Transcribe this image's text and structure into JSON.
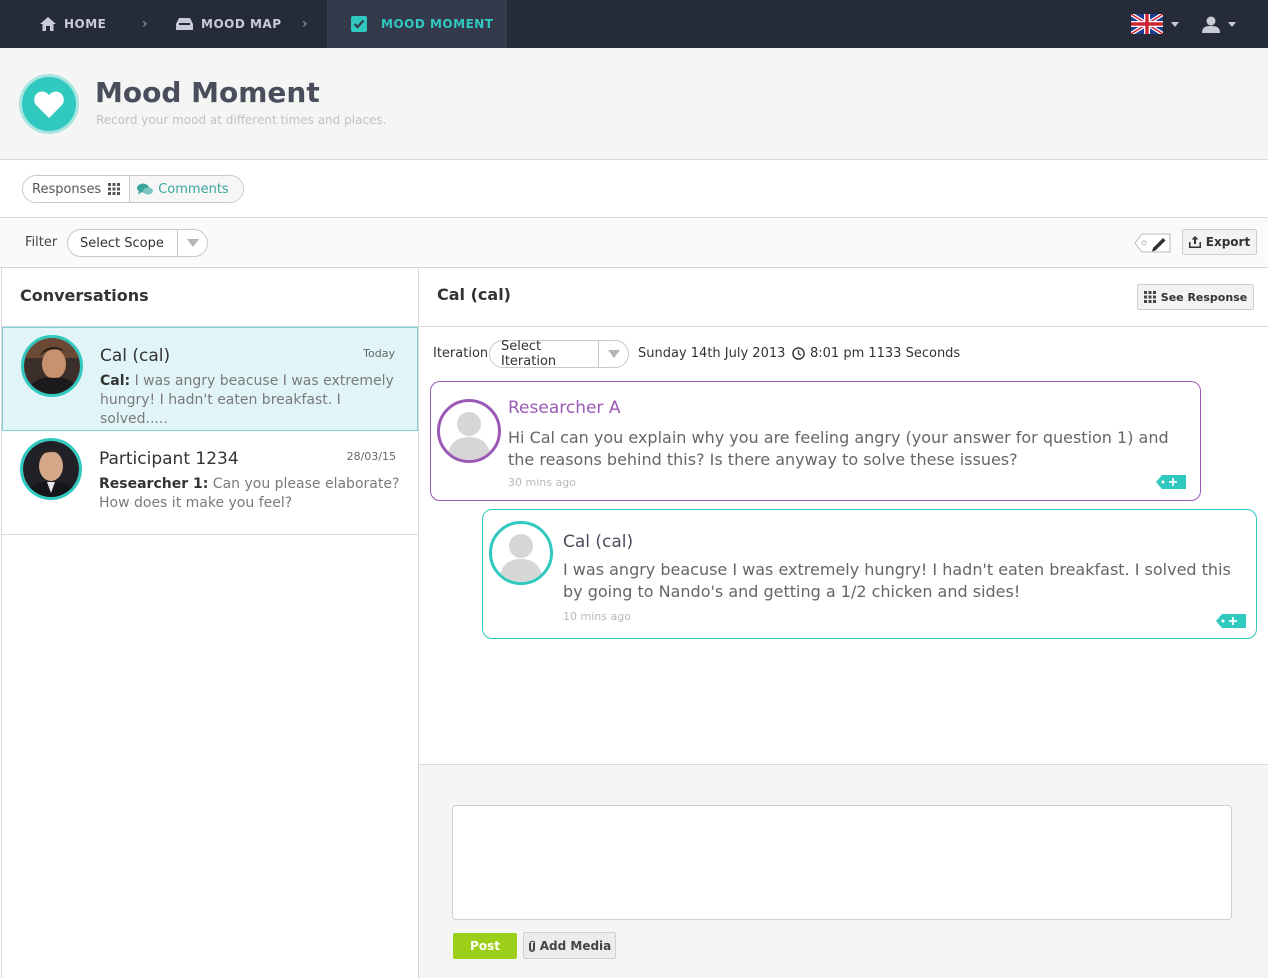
{
  "nav": {
    "home": "HOME",
    "mood_map": "MOOD MAP",
    "mood_moment": "MOOD MOMENT",
    "separator": "›"
  },
  "header": {
    "title": "Mood Moment",
    "subtitle": "Record your mood at different times and places."
  },
  "tabs": {
    "responses": "Responses",
    "comments": "Comments"
  },
  "filter": {
    "label": "Filter",
    "scope_value": "Select Scope",
    "export": "Export"
  },
  "conversations": {
    "title": "Conversations",
    "items": [
      {
        "name": "Cal  (cal)",
        "date": "Today",
        "sender": "Cal:",
        "text": "I was angry beacuse I was extremely hungry! I hadn't eaten breakfast. I solved....."
      },
      {
        "name": "Participant 1234",
        "date": "28/03/15",
        "sender": "Researcher 1:",
        "text": "Can you please elaborate? How does it make you feel?"
      }
    ]
  },
  "chat": {
    "title": "Cal (cal)",
    "see_response": "See Response",
    "iteration_label": "Iteration",
    "iteration_value": "Select Iteration",
    "date": "Sunday 14th July 2013",
    "time": "8:01 pm 1133 Seconds",
    "messages": [
      {
        "author": "Researcher A",
        "text": "Hi Cal can you explain why you are feeling angry (your answer for question 1) and the reasons behind this? Is there anyway to solve these issues?",
        "ago": "30 mins ago"
      },
      {
        "author": "Cal (cal)",
        "text": "I was angry beacuse I was extremely hungry! I hadn't eaten breakfast. I solved this by going to Nando's and getting a 1/2 chicken and sides!",
        "ago": "10 mins ago"
      }
    ]
  },
  "composer": {
    "post": "Post",
    "add_media": "Add Media"
  },
  "colors": {
    "nav_bg": "#262b3a",
    "teal": "#2fc9c0",
    "purple": "#9b59b6",
    "post_green": "#9ccf19",
    "selected_bg": "#e1f4f8"
  }
}
